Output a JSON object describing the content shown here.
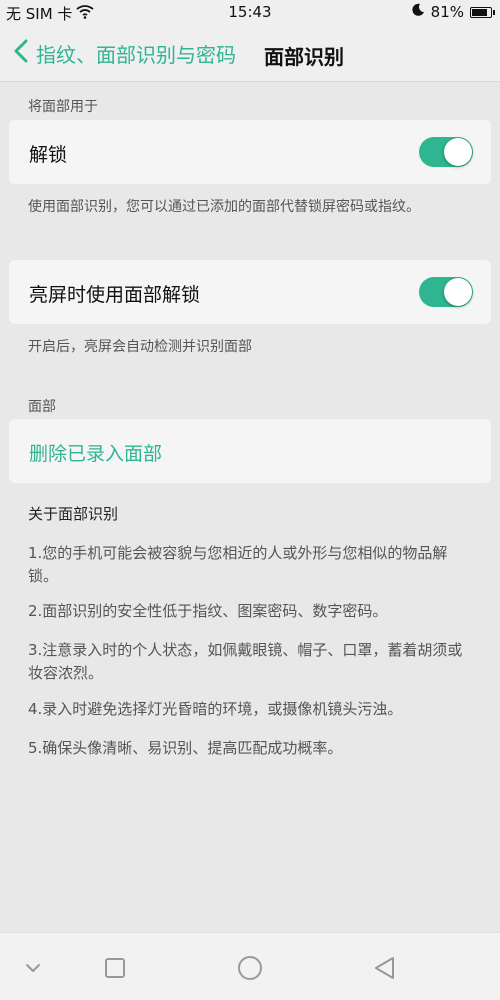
{
  "status_bar": {
    "carrier": "无 SIM 卡",
    "time": "15:43",
    "battery": "81%",
    "battery_level": 0.81
  },
  "header": {
    "back_label": "指纹、面部识别与密码",
    "title": "面部识别"
  },
  "use_face_for": {
    "label": "将面部用于",
    "unlock": {
      "title": "解锁",
      "enabled": true,
      "description": "使用面部识别，您可以通过已添加的面部代替锁屏密码或指纹。"
    },
    "screen_on_unlock": {
      "title": "亮屏时使用面部解锁",
      "enabled": true,
      "description": "开启后，亮屏会自动检测并识别面部"
    }
  },
  "face": {
    "label": "面部",
    "delete_label": "删除已录入面部"
  },
  "about": {
    "title": "关于面部识别",
    "items": [
      "1.您的手机可能会被容貌与您相近的人或外形与您相似的物品解锁。",
      "2.面部识别的安全性低于指纹、图案密码、数字密码。",
      "3.注意录入时的个人状态，如佩戴眼镜、帽子、口罩，蓄着胡须或妆容浓烈。",
      "4.录入时避免选择灯光昏暗的环境，或摄像机镜头污浊。",
      "5.确保头像清晰、易识别、提高匹配成功概率。"
    ]
  },
  "colors": {
    "accent": "#2fb58f",
    "background": "#e8e8e8",
    "card": "#f5f5f5"
  },
  "nav": {
    "icons": [
      "chevron-down-icon",
      "square-icon",
      "circle-icon",
      "triangle-back-icon"
    ]
  }
}
